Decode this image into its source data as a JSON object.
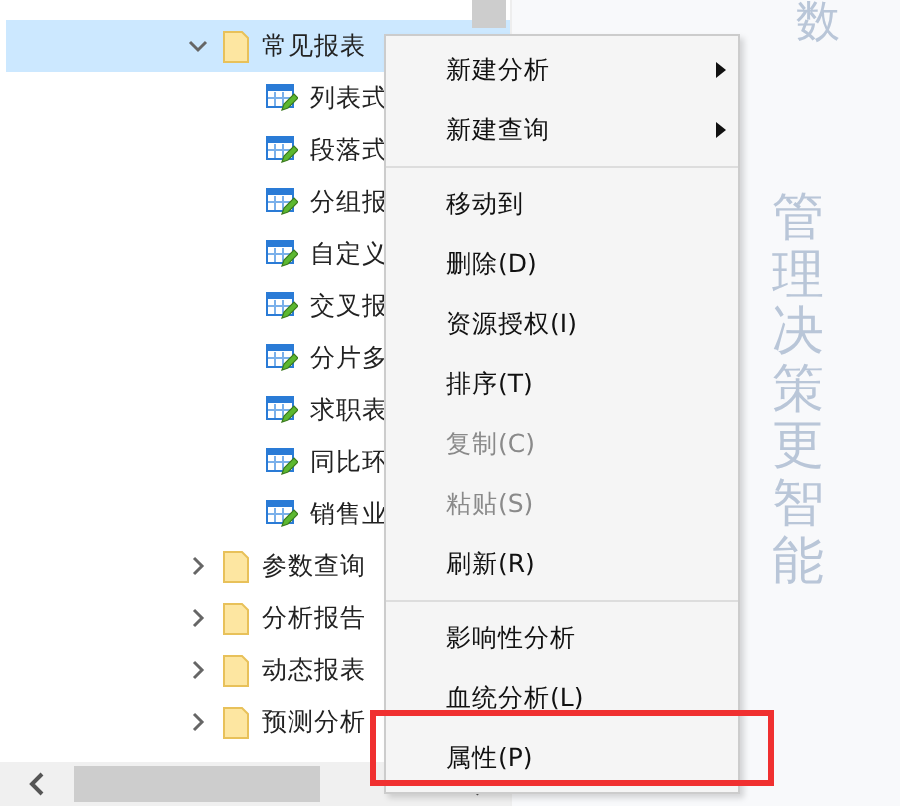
{
  "tree": {
    "items": [
      {
        "label": "常见报表",
        "kind": "folder",
        "expanded": true,
        "selected": true,
        "children": [
          {
            "label": "列表式",
            "kind": "report"
          },
          {
            "label": "段落式",
            "kind": "report"
          },
          {
            "label": "分组报",
            "kind": "report"
          },
          {
            "label": "自定义",
            "kind": "report"
          },
          {
            "label": "交叉报",
            "kind": "report"
          },
          {
            "label": "分片多",
            "kind": "report"
          },
          {
            "label": "求职表",
            "kind": "report"
          },
          {
            "label": "同比环",
            "kind": "report"
          },
          {
            "label": "销售业",
            "kind": "report"
          }
        ]
      },
      {
        "label": "参数查询",
        "kind": "folder",
        "expanded": false,
        "selected": false
      },
      {
        "label": "分析报告",
        "kind": "folder",
        "expanded": false,
        "selected": false
      },
      {
        "label": "动态报表",
        "kind": "folder",
        "expanded": false,
        "selected": false
      },
      {
        "label": "预测分析",
        "kind": "folder",
        "expanded": false,
        "selected": false
      }
    ]
  },
  "background": {
    "top_text": "数",
    "slogan": "管理决策更智能"
  },
  "annotation": {
    "kind": "frame"
  },
  "context_menu": {
    "groups": [
      [
        {
          "label": "新建分析",
          "submenu": true,
          "disabled": false
        },
        {
          "label": "新建查询",
          "submenu": true,
          "disabled": false
        }
      ],
      [
        {
          "label": "移动到",
          "submenu": false,
          "disabled": false
        },
        {
          "label": "删除(D)",
          "submenu": false,
          "disabled": false
        },
        {
          "label": "资源授权(I)",
          "submenu": false,
          "disabled": false
        },
        {
          "label": "排序(T)",
          "submenu": false,
          "disabled": false
        },
        {
          "label": "复制(C)",
          "submenu": false,
          "disabled": true
        },
        {
          "label": "粘贴(S)",
          "submenu": false,
          "disabled": true
        },
        {
          "label": "刷新(R)",
          "submenu": false,
          "disabled": false
        }
      ],
      [
        {
          "label": "影响性分析",
          "submenu": false,
          "disabled": false
        },
        {
          "label": "血统分析(L)",
          "submenu": false,
          "disabled": false
        },
        {
          "label": "属性(P)",
          "submenu": false,
          "disabled": false
        }
      ]
    ]
  }
}
